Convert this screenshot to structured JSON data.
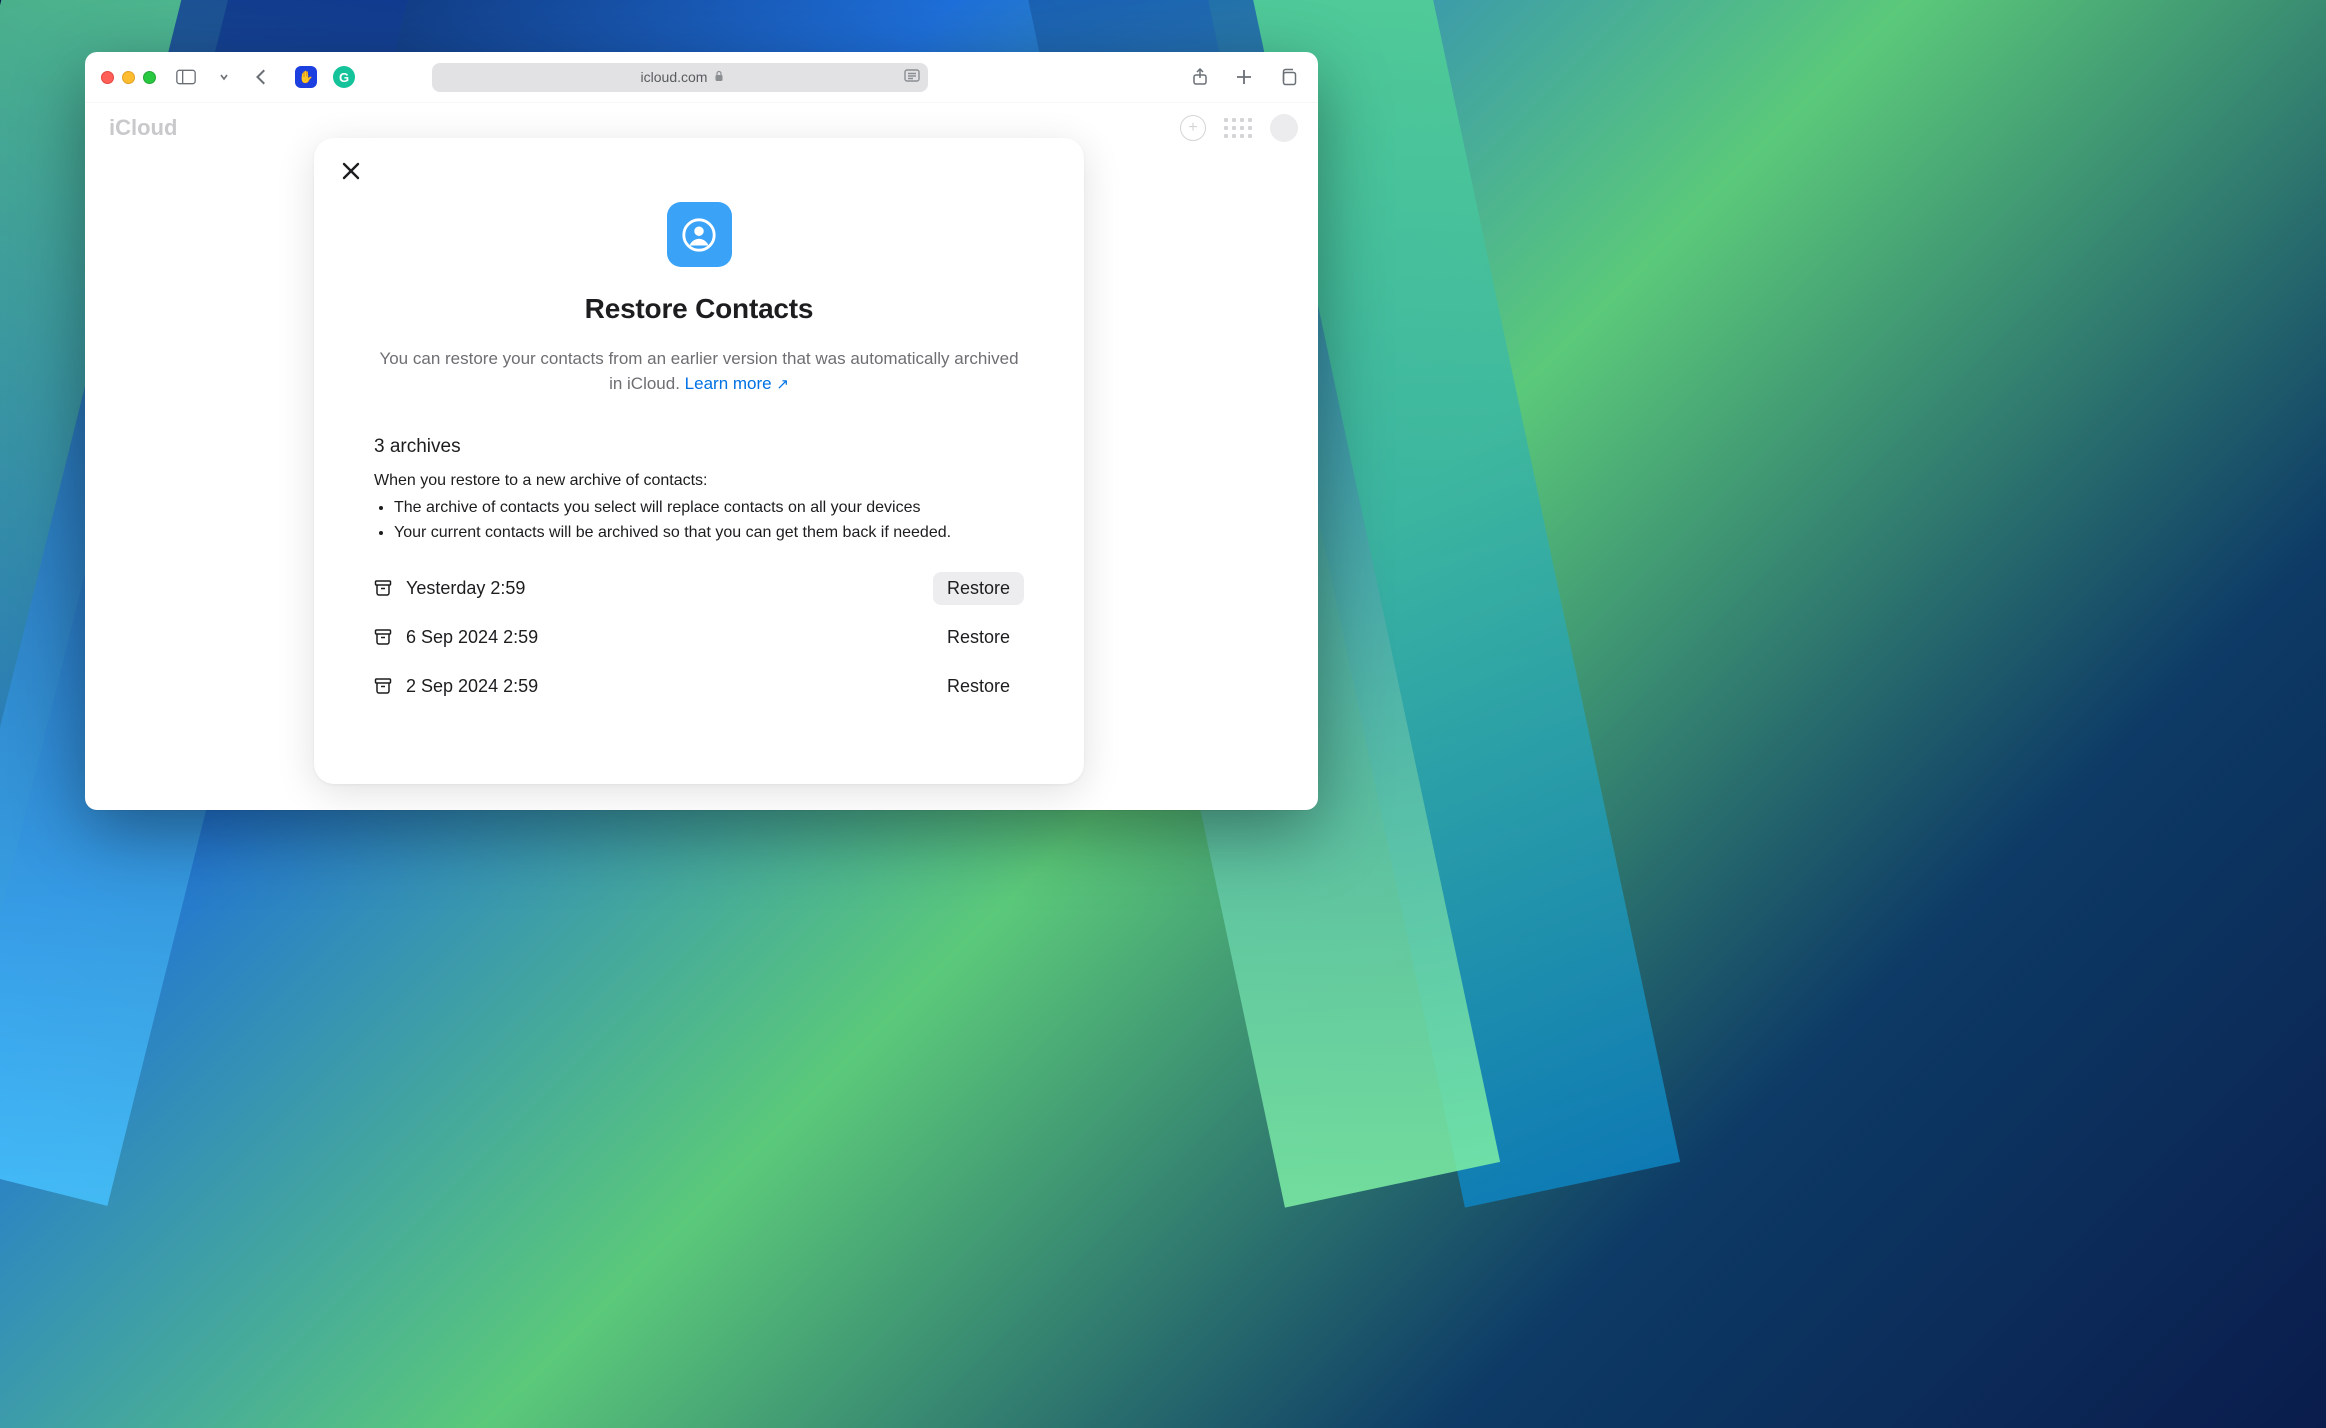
{
  "browser": {
    "address_host": "icloud.com"
  },
  "page": {
    "brand": "iCloud"
  },
  "modal": {
    "title": "Restore Contacts",
    "description_prefix": "You can restore your contacts from an earlier version that was automatically archived in iCloud. ",
    "learn_more_label": "Learn more",
    "archives_count_label": "3 archives",
    "restore_note": "When you restore to a new archive of contacts:",
    "bullets": [
      "The archive of contacts you select will replace contacts on all your devices",
      "Your current contacts will be archived so that you can get them back if needed."
    ],
    "restore_button_label": "Restore",
    "archives": [
      {
        "date": "Yesterday 2:59",
        "highlighted": true
      },
      {
        "date": "6 Sep 2024 2:59",
        "highlighted": false
      },
      {
        "date": "2 Sep 2024 2:59",
        "highlighted": false
      }
    ]
  }
}
